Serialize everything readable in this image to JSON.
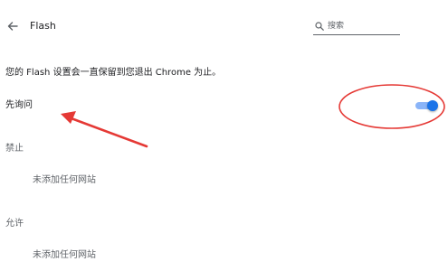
{
  "header": {
    "title": "Flash",
    "back_icon": "arrow-back-icon",
    "search": {
      "icon": "search-icon",
      "placeholder": "搜索"
    }
  },
  "info": {
    "text": "您的 Flash 设置会一直保留到您退出 Chrome 为止。"
  },
  "ask_first": {
    "label": "先询问",
    "toggle_on": true,
    "toggle_color": "#1a73e8"
  },
  "blocked": {
    "heading": "禁止",
    "empty_message": "未添加任何网站"
  },
  "allowed": {
    "heading": "允许",
    "empty_message": "未添加任何网站"
  },
  "annotation_color": "#e53935"
}
